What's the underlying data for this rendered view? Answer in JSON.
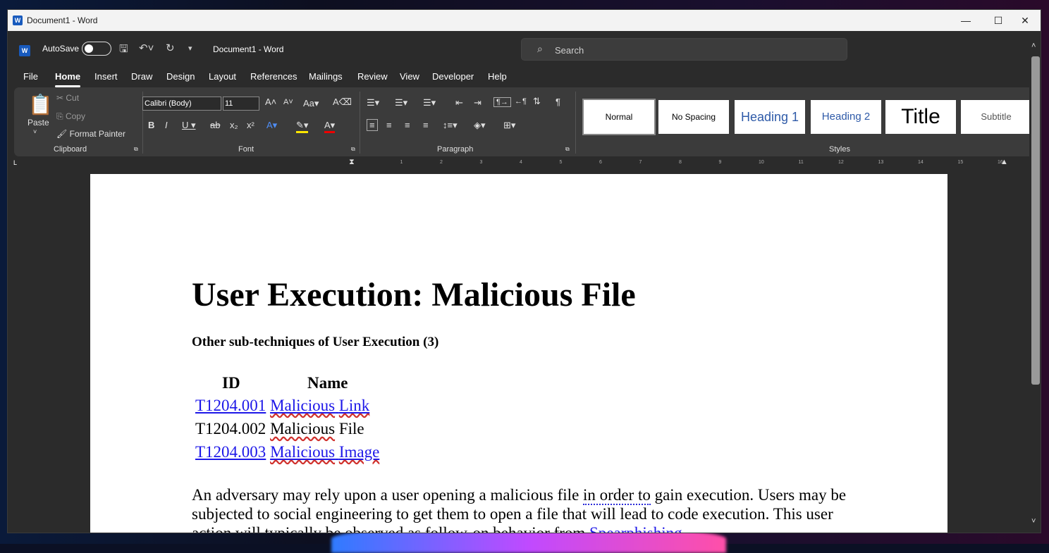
{
  "window": {
    "title": "Document1 - Word",
    "app_letter": "W",
    "controls": {
      "minimize": "—",
      "maximize": "☐",
      "close": "✕"
    }
  },
  "qat": {
    "autosave": "AutoSave",
    "doc_name": "Document1  -  Word",
    "search_placeholder": "Search"
  },
  "tabs": [
    "File",
    "Home",
    "Insert",
    "Draw",
    "Design",
    "Layout",
    "References",
    "Mailings",
    "Review",
    "View",
    "Developer",
    "Help"
  ],
  "active_tab": "Home",
  "ribbon": {
    "clipboard": {
      "paste": "Paste",
      "cut": "Cut",
      "copy": "Copy",
      "format_painter": "Format Painter",
      "label": "Clipboard"
    },
    "font": {
      "font_name": "Calibri (Body)",
      "font_size": "11",
      "label": "Font"
    },
    "paragraph": {
      "label": "Paragraph"
    },
    "styles": {
      "items": [
        "Normal",
        "No Spacing",
        "Heading 1",
        "Heading 2",
        "Title",
        "Subtitle"
      ],
      "label": "Styles"
    }
  },
  "document": {
    "title": "User Execution: Malicious File",
    "subtitle": "Other sub-techniques of User Execution (3)",
    "table": {
      "headers": [
        "ID",
        "Name"
      ],
      "rows": [
        {
          "id": "T1204.001",
          "name_a": "Malicious",
          "name_b": "Link",
          "linked": true
        },
        {
          "id": "T1204.002",
          "name_a": "Malicious",
          "name_b": "File",
          "linked": false
        },
        {
          "id": "T1204.003",
          "name_a": "Malicious",
          "name_b": "Image",
          "linked": true
        }
      ]
    },
    "para_1a": "An adversary may rely upon a user opening a malicious file ",
    "para_1b": "in order to",
    "para_1c": " gain execution. Users may be subjected to social engineering to get them to open a file that will lead to code execution.",
    "para_2a": "This user action will typically be observed as follow-on behavior from ",
    "para_2b": "Spearphishing"
  },
  "colors": {
    "link": "#1d17e8",
    "accent": "#185abd"
  }
}
